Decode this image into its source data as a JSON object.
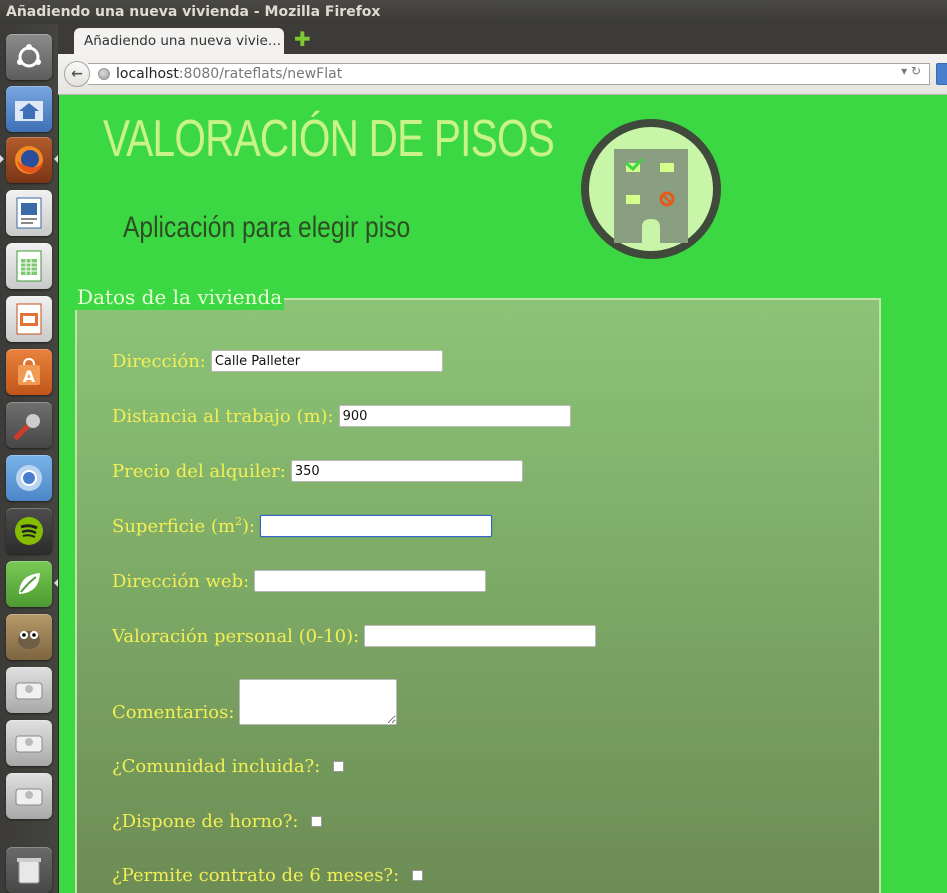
{
  "window": {
    "title": "Añadiendo una nueva vivienda - Mozilla Firefox"
  },
  "browser": {
    "tab_title": "Añadiendo una nueva vivie…",
    "url_host": "localhost",
    "url_rest": ":8080/rateflats/newFlat",
    "new_tab_icon": "plus-icon"
  },
  "launcher": {
    "items": [
      "ubuntu-dash-icon",
      "home-folder-icon",
      "firefox-icon",
      "writer-icon",
      "calc-icon",
      "impress-icon",
      "software-center-icon",
      "system-settings-icon",
      "chromium-icon",
      "spotify-icon",
      "spring-leaf-icon",
      "gimp-icon",
      "drive-icon",
      "drive-icon",
      "drive-icon",
      "trash-icon"
    ]
  },
  "header": {
    "title": "VALORACIÓN DE PISOS",
    "subtitle": "Aplicación para elegir piso"
  },
  "form": {
    "legend": "Datos de la vivienda",
    "fields": {
      "direccion": {
        "label": "Dirección:",
        "value": "Calle Palleter"
      },
      "distancia": {
        "label": "Distancia al trabajo (m):",
        "value": "900"
      },
      "precio": {
        "label": "Precio del alquiler:",
        "value": "350"
      },
      "superficie": {
        "label_prefix": "Superficie (m",
        "label_sup": "2",
        "label_suffix": "):",
        "value": ""
      },
      "web": {
        "label": "Dirección web:",
        "value": ""
      },
      "valoracion": {
        "label": "Valoración personal (0-10):",
        "value": ""
      },
      "comentarios": {
        "label": "Comentarios:",
        "value": ""
      },
      "comunidad": {
        "label": "¿Comunidad incluida?:",
        "checked": false
      },
      "horno": {
        "label": "¿Dispone de horno?:",
        "checked": false
      },
      "contrato": {
        "label": "¿Permite contrato de 6 meses?:",
        "checked": false
      }
    }
  },
  "colors": {
    "page_bg": "#3bd844",
    "title": "#c9f28a",
    "subtitle": "#2e4d24",
    "label": "#f3ef54",
    "legend": "#e9ffd3"
  }
}
